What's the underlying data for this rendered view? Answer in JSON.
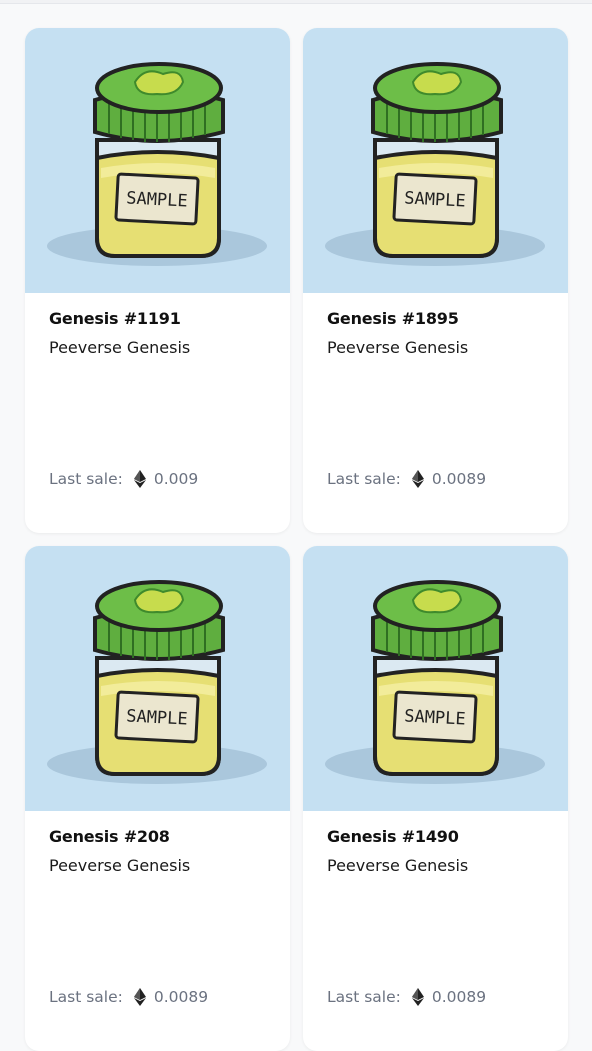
{
  "colors": {
    "card_bg": "#ffffff",
    "art_bg": "#c5e0f2",
    "title_text": "#111111",
    "muted_text": "#6b7280",
    "lid_green": "#5fae3f",
    "liquid_yellow": "#e6df73"
  },
  "cards": [
    {
      "title": "Genesis #1191",
      "collection": "Peeverse Genesis",
      "last_sale_label": "Last sale:",
      "price": "0.009",
      "image_icon": "sample-jar-image",
      "currency_icon": "ethereum-icon"
    },
    {
      "title": "Genesis #1895",
      "collection": "Peeverse Genesis",
      "last_sale_label": "Last sale:",
      "price": "0.0089",
      "image_icon": "sample-jar-image",
      "currency_icon": "ethereum-icon"
    },
    {
      "title": "Genesis #208",
      "collection": "Peeverse Genesis",
      "last_sale_label": "Last sale:",
      "price": "0.0089",
      "image_icon": "sample-jar-image",
      "currency_icon": "ethereum-icon"
    },
    {
      "title": "Genesis #1490",
      "collection": "Peeverse Genesis",
      "last_sale_label": "Last sale:",
      "price": "0.0089",
      "image_icon": "sample-jar-image",
      "currency_icon": "ethereum-icon"
    }
  ],
  "jar_label": "SAMPLE"
}
